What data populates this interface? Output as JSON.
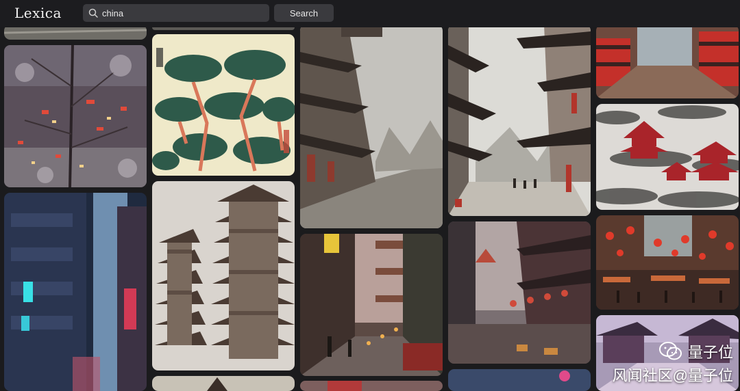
{
  "app": {
    "logo": "Lexica"
  },
  "search": {
    "value": "china",
    "button_label": "Search"
  },
  "watermark": {
    "brand": "量子位",
    "source": "风闻社区@量子位"
  }
}
